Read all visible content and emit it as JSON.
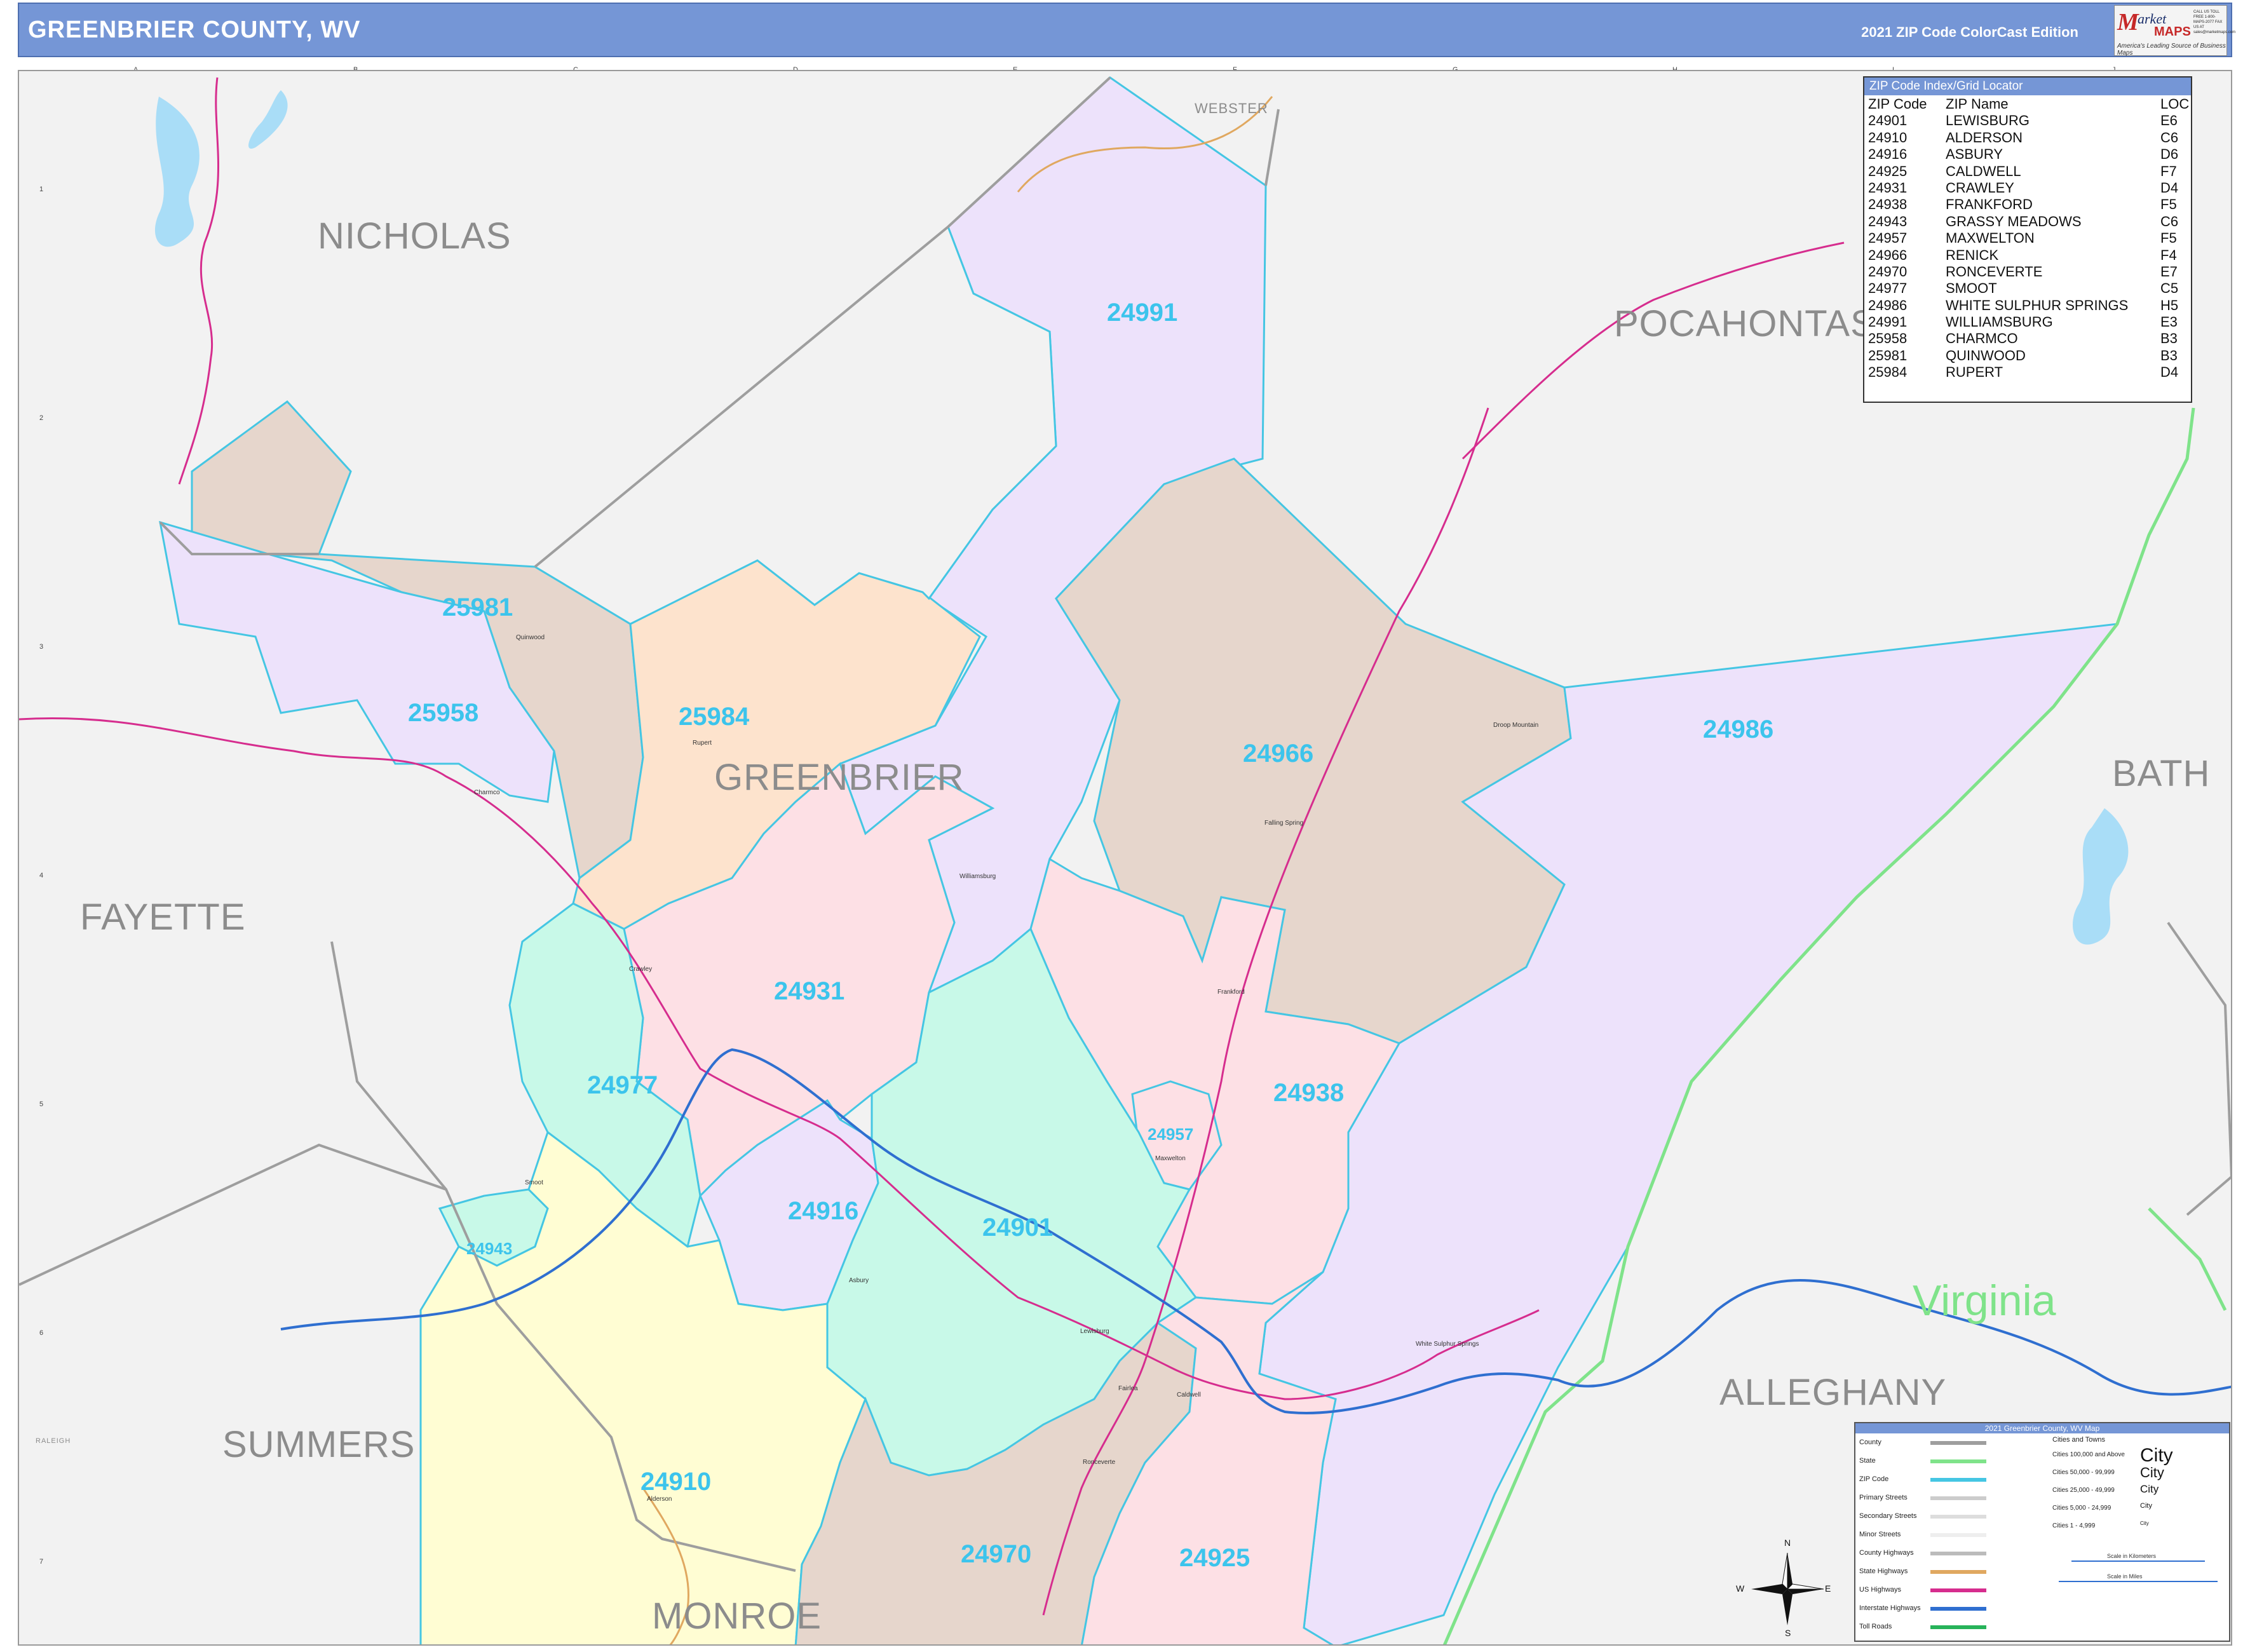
{
  "header": {
    "title": "GREENBRIER COUNTY, WV",
    "edition": "2021 ZIP Code ColorCast Edition",
    "logo": {
      "mark": "M",
      "word": "arket",
      "maps": "MAPS",
      "tagline": "America's Leading Source of Business Maps",
      "contact": "CALL US TOLL FREE 1-800-MAPS-2077 FAX US AT sales@marketmaps.com"
    }
  },
  "grid": {
    "letters": [
      "A",
      "B",
      "C",
      "D",
      "E",
      "F",
      "G",
      "H",
      "I",
      "J"
    ],
    "numbers": [
      "1",
      "2",
      "3",
      "4",
      "5",
      "6",
      "7"
    ]
  },
  "counties": {
    "nicholas": "NICHOLAS",
    "pocahontas": "POCAHONTAS",
    "greenbrier": "GREENBRIER",
    "bath": "BATH",
    "fayette": "FAYETTE",
    "summers": "SUMMERS",
    "alleghany": "ALLEGHANY",
    "monroe": "MONROE",
    "webster": "WEBSTER",
    "raleigh": "RALEIGH"
  },
  "states": {
    "virginia": "Virginia"
  },
  "colors": {
    "lavender": "#ede2fb",
    "tan": "#e6d6cc",
    "peach": "#fde3cd",
    "pink": "#fde0e5",
    "mint": "#c8f9e8",
    "yellow": "#fffdd3",
    "zip_boundary": "#45c6e3",
    "county_line": "#9e9e9e",
    "state_line": "#7fe38a",
    "us_highway": "#d62d8e",
    "interstate": "#2f6fd0",
    "state_highway": "#e0a860",
    "header_blue": "#7596d6"
  },
  "zip_labels": {
    "z24991": "24991",
    "z25981": "25981",
    "z25958": "25958",
    "z25984": "25984",
    "z24966": "24966",
    "z24986": "24986",
    "z24931": "24931",
    "z24977": "24977",
    "z24938": "24938",
    "z24957": "24957",
    "z24916": "24916",
    "z24901": "24901",
    "z24943": "24943",
    "z24910": "24910",
    "z24970": "24970",
    "z24925": "24925"
  },
  "zip_index": {
    "title": "ZIP Code Index/Grid Locator",
    "header": {
      "zip": "ZIP Code",
      "name": "ZIP Name",
      "loc": "LOC"
    },
    "rows": [
      {
        "zip": "24901",
        "name": "LEWISBURG",
        "loc": "E6"
      },
      {
        "zip": "24910",
        "name": "ALDERSON",
        "loc": "C6"
      },
      {
        "zip": "24916",
        "name": "ASBURY",
        "loc": "D6"
      },
      {
        "zip": "24925",
        "name": "CALDWELL",
        "loc": "F7"
      },
      {
        "zip": "24931",
        "name": "CRAWLEY",
        "loc": "D4"
      },
      {
        "zip": "24938",
        "name": "FRANKFORD",
        "loc": "F5"
      },
      {
        "zip": "24943",
        "name": "GRASSY MEADOWS",
        "loc": "C6"
      },
      {
        "zip": "24957",
        "name": "MAXWELTON",
        "loc": "F5"
      },
      {
        "zip": "24966",
        "name": "RENICK",
        "loc": "F4"
      },
      {
        "zip": "24970",
        "name": "RONCEVERTE",
        "loc": "E7"
      },
      {
        "zip": "24977",
        "name": "SMOOT",
        "loc": "C5"
      },
      {
        "zip": "24986",
        "name": "WHITE SULPHUR SPRINGS",
        "loc": "H5"
      },
      {
        "zip": "24991",
        "name": "WILLIAMSBURG",
        "loc": "E3"
      },
      {
        "zip": "25958",
        "name": "CHARMCO",
        "loc": "B3"
      },
      {
        "zip": "25981",
        "name": "QUINWOOD",
        "loc": "B3"
      },
      {
        "zip": "25984",
        "name": "RUPERT",
        "loc": "D4"
      }
    ]
  },
  "legend": {
    "title": "2021 Greenbrier County, WV Map",
    "lines": [
      "County",
      "State",
      "ZIP Code",
      "Primary Streets",
      "Secondary Streets",
      "Minor Streets",
      "County Highways",
      "State Highways",
      "US Highways",
      "Interstate Highways",
      "Toll Roads"
    ],
    "cities_header": "Cities and Towns",
    "cities": [
      {
        "label": "Cities 100,000 and Above",
        "sym": "City"
      },
      {
        "label": "Cities 50,000 - 99,999",
        "sym": "City"
      },
      {
        "label": "Cities 25,000 - 49,999",
        "sym": "City"
      },
      {
        "label": "Cities 5,000 - 24,999",
        "sym": "City"
      },
      {
        "label": "Cities 1 - 4,999",
        "sym": "City"
      }
    ],
    "scale_km": "Scale in Kilometers",
    "scale_mi": "Scale in Miles"
  },
  "compass": {
    "n": "N",
    "s": "S",
    "e": "E",
    "w": "W"
  },
  "towns": {
    "lewisburg": "Lewisburg",
    "ronceverte": "Ronceverte",
    "alderson": "Alderson",
    "wss": "White Sulphur Springs",
    "renick": "Renick",
    "rupert": "Rupert",
    "quinwood": "Quinwood",
    "charmco": "Charmco",
    "williamsburg": "Williamsburg",
    "frankford": "Frankford",
    "maxwelton": "Maxwelton",
    "asbury": "Asbury",
    "caldwell": "Caldwell",
    "smoot": "Smoot",
    "crawley": "Crawley",
    "fairlea": "Fairlea",
    "falling_spring": "Falling Spring",
    "droop_mountain": "Droop Mountain"
  }
}
